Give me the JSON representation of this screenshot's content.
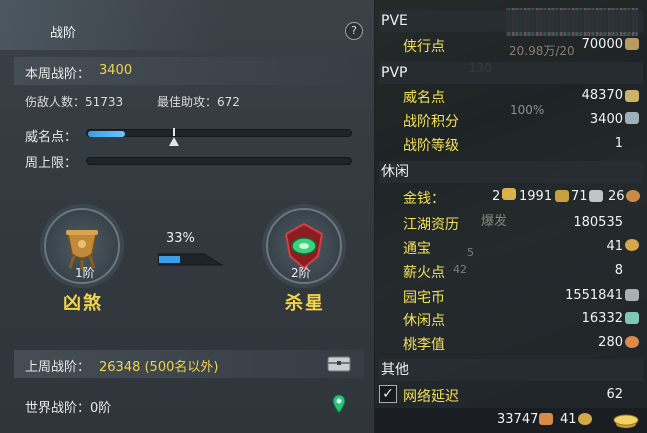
{
  "left": {
    "title": "战阶",
    "help": "?",
    "week_rank_label": "本周战阶：",
    "week_rank_value": "3400",
    "defeated_label": "伤敌人数：51733",
    "assist_label": "最佳助攻：672",
    "prestige_label": "威名点：",
    "prestige_fill": 0.14,
    "weekly_cap_label": "周上限：",
    "weekly_cap_fill": 0.0,
    "current_rank": {
      "level": "1阶",
      "name": "凶煞"
    },
    "next_rank": {
      "level": "2阶",
      "name": "杀星"
    },
    "progress_pct_text": "33%",
    "progress_pct": 0.33,
    "last_week_label": "上周战阶：",
    "last_week_value": "26348 (500名以外)",
    "world_rank_label": "世界战阶：0阶"
  },
  "right": {
    "sections": {
      "pve": "PVE",
      "pvp": "PVP",
      "leisure": "休闲",
      "other": "其他"
    },
    "pve_items": [
      {
        "label": "侠行点",
        "value": "70000"
      }
    ],
    "pvp_items": [
      {
        "label": "威名点",
        "value": "48370"
      },
      {
        "label": "战阶积分",
        "value": "3400"
      },
      {
        "label": "战阶等级",
        "value": "1"
      }
    ],
    "money": {
      "label": "金钱：",
      "gold": "2",
      "silver": "1991",
      "copper": "71",
      "wen": "26"
    },
    "leisure_items": [
      {
        "label": "江湖资历",
        "value": "180535"
      },
      {
        "label": "通宝",
        "value": "41"
      },
      {
        "label": "薪火点",
        "value": "8"
      },
      {
        "label": "园宅币",
        "value": "1551841"
      },
      {
        "label": "休闲点",
        "value": "16332"
      },
      {
        "label": "桃李值",
        "value": "280"
      }
    ],
    "other_items": [
      {
        "label": "网络延迟",
        "value": "62"
      }
    ],
    "bottom": {
      "value1": "33747",
      "value2": "41"
    },
    "background_text": {
      "bar_value": "20.98万/20",
      "hp": "130",
      "pct": "100%",
      "skill": "爆发",
      "lvl": "5",
      "lvl2": "42"
    }
  },
  "colors": {
    "accent_yellow": "#f0d64a",
    "bar_blue": "#3a9ee8",
    "label_yellow": "#f2e15a"
  }
}
